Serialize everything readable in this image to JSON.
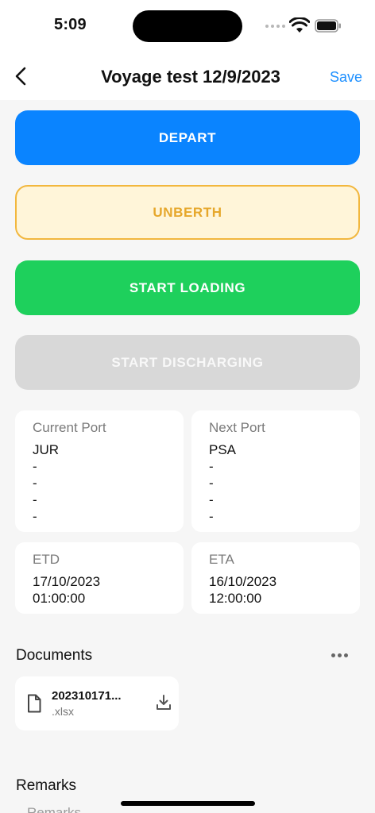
{
  "status": {
    "time": "5:09"
  },
  "header": {
    "title": "Voyage test 12/9/2023",
    "save_label": "Save"
  },
  "actions": {
    "depart": "DEPART",
    "unberth": "UNBERTH",
    "start_loading": "START LOADING",
    "start_discharging": "START DISCHARGING"
  },
  "ports": {
    "current": {
      "label": "Current Port",
      "lines": [
        "JUR",
        "-",
        "-",
        "-",
        "-"
      ]
    },
    "next": {
      "label": "Next Port",
      "lines": [
        "PSA",
        "-",
        "-",
        "-",
        "-"
      ]
    }
  },
  "times": {
    "etd": {
      "label": "ETD",
      "date": "17/10/2023",
      "time": "01:00:00"
    },
    "eta": {
      "label": "ETA",
      "date": "16/10/2023",
      "time": "12:00:00"
    }
  },
  "documents": {
    "title": "Documents",
    "items": [
      {
        "name": "202310171...",
        "ext": ".xlsx"
      }
    ]
  },
  "remarks": {
    "title": "Remarks",
    "placeholder": "Remarks"
  },
  "colors": {
    "depart": "#0a84ff",
    "unberth_bg": "#fff5d9",
    "unberth_border": "#f2b73e",
    "loading": "#1ed05c",
    "discharging_disabled": "#d8d8d8",
    "link": "#1e90ff"
  }
}
